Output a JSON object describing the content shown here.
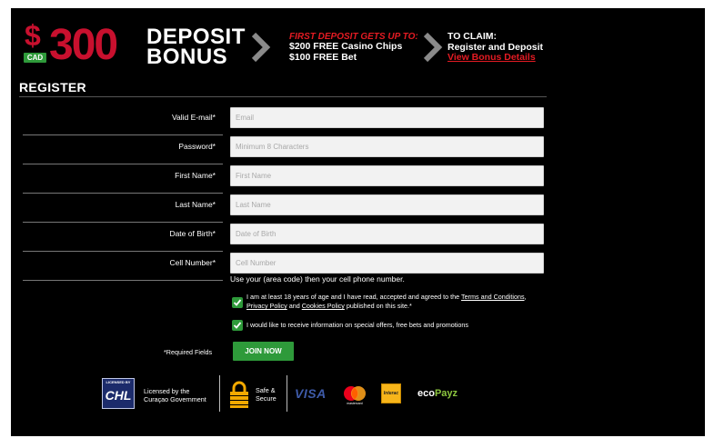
{
  "banner": {
    "currency_symbol": "$",
    "currency_code": "CAD",
    "amount": "300",
    "title_line1": "DEPOSIT",
    "title_line2": "BONUS",
    "offer_heading": "FIRST DEPOSIT GETS UP TO:",
    "offer_line1": "$200 FREE Casino Chips",
    "offer_line2": "$100 FREE Bet",
    "claim_heading": "TO CLAIM:",
    "claim_line": "Register and Deposit",
    "claim_link": "View Bonus Details"
  },
  "register": {
    "title": "REGISTER",
    "fields": [
      {
        "label": "Valid E-mail*",
        "placeholder": "Email",
        "value": ""
      },
      {
        "label": "Password*",
        "placeholder": "Minimum 8 Characters",
        "value": ""
      },
      {
        "label": "First Name*",
        "placeholder": "First Name",
        "value": ""
      },
      {
        "label": "Last Name*",
        "placeholder": "Last Name",
        "value": ""
      },
      {
        "label": "Date of Birth*",
        "placeholder": "Date of Birth",
        "value": ""
      },
      {
        "label": "Cell Number*",
        "placeholder": "Cell Number",
        "value": ""
      }
    ],
    "cell_hint": "Use your (area code) then your cell phone number.",
    "terms": {
      "checked": true,
      "text_before": "I am at least 18 years of age and I have read, accepted and agreed to the ",
      "link_terms": "Terms and Conditions",
      "sep1": ", ",
      "link_privacy": "Privacy Policy",
      "sep2": " and ",
      "link_cookies": "Cookies Policy",
      "text_after": " published on this site.*"
    },
    "promotions": {
      "checked": true,
      "text": "I would like to receive information on special offers, free bets and promotions"
    },
    "required_note": "*Required Fields",
    "submit_label": "JOIN NOW"
  },
  "footer": {
    "license_badge_top": "LICENSED BY",
    "license_badge_main": "CHL",
    "license_line1": "Licensed by the",
    "license_line2": "Curaçao Government",
    "safe_line1": "Safe &",
    "safe_line2": "Secure",
    "visa": "VISA",
    "mastercard": "mastercard",
    "interac": "Interac",
    "ecopayz_eco": "eco",
    "ecopayz_payz": "Payz"
  },
  "colors": {
    "accent_red": "#c8102e",
    "link_red": "#e41b23",
    "green": "#2e9a3a",
    "background": "#000000"
  }
}
